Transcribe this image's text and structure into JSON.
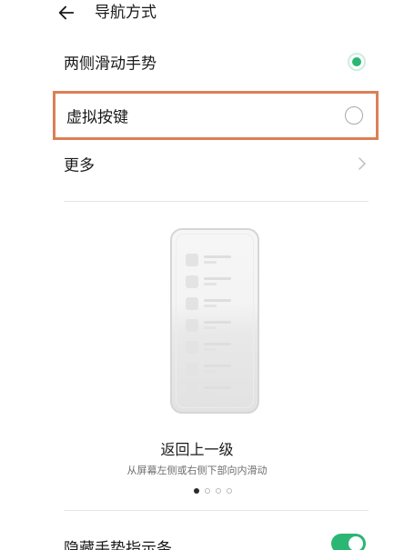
{
  "header": {
    "back_icon": "back-arrow-icon",
    "title": "导航方式"
  },
  "options": [
    {
      "label": "两侧滑动手势",
      "selected": true
    },
    {
      "label": "虚拟按键",
      "selected": false
    },
    {
      "label": "更多",
      "icon": "chevron-right-icon"
    }
  ],
  "gesture_preview": {
    "title": "返回上一级",
    "description": "从屏幕左侧或右侧下部向内滑动",
    "page_count": 4,
    "current_page": 1
  },
  "settings": {
    "hide_indicator_label": "隐藏手势指示条",
    "hide_indicator_on": true
  },
  "colors": {
    "accent": "#2bb673",
    "highlight_border": "#dc7f55"
  }
}
